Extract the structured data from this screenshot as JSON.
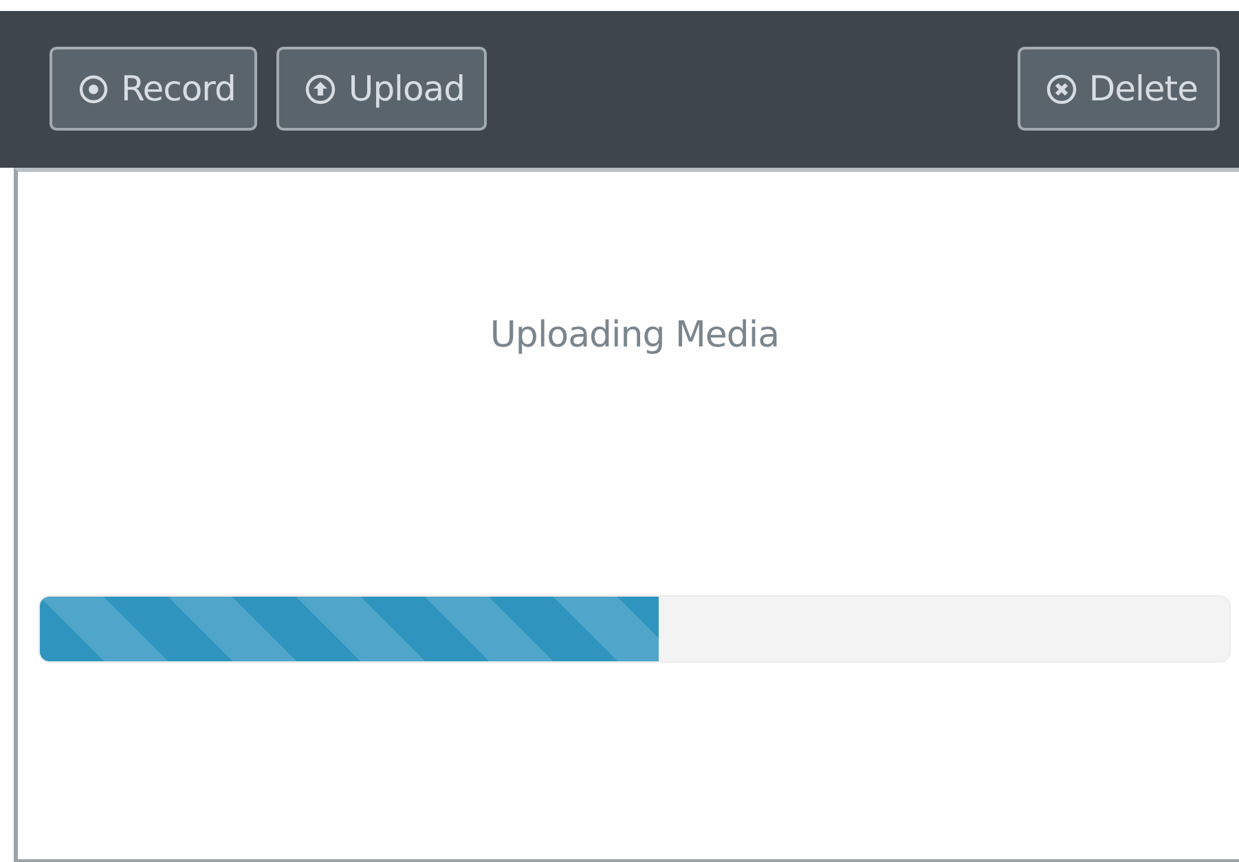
{
  "toolbar": {
    "left_buttons": [
      {
        "label": "Record",
        "kind": "record"
      },
      {
        "label": "Upload",
        "kind": "upload"
      }
    ],
    "right_buttons": [
      {
        "label": "Delete",
        "kind": "delete"
      }
    ]
  },
  "status": {
    "message": "Uploading Media"
  },
  "progress": {
    "level": 0.52
  }
}
